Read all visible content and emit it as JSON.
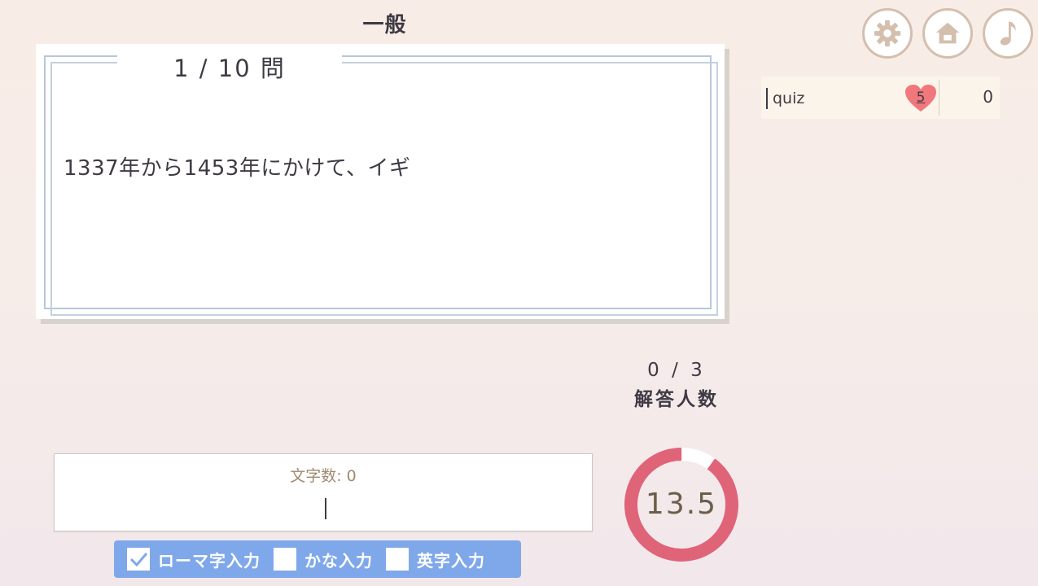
{
  "header": {
    "category": "一般"
  },
  "question": {
    "counter": "1 / 10 問",
    "text": "1337年から1453年にかけて、イギ"
  },
  "toolbar": {
    "buttons": [
      {
        "icon": "gear-icon",
        "label": "settings"
      },
      {
        "icon": "home-icon",
        "label": "home"
      },
      {
        "icon": "music-note-icon",
        "label": "sound"
      }
    ]
  },
  "players": [
    {
      "name": "quiz",
      "lives": "5",
      "score": "0"
    }
  ],
  "answers": {
    "count": "0 / 3",
    "label": "解答人数"
  },
  "timer": {
    "value": "13.5",
    "remaining_fraction": 0.9,
    "ring_color": "#e06478",
    "track_color": "#ffffff"
  },
  "input": {
    "char_count": "文字数: 0",
    "value": ""
  },
  "input_modes": [
    {
      "label": "ローマ字入力",
      "checked": true
    },
    {
      "label": "かな入力",
      "checked": false
    },
    {
      "label": "英字入力",
      "checked": false
    }
  ],
  "colors": {
    "accent": "#7fa8ea",
    "heart": "#f0787c",
    "icon_border": "#d4bfae"
  }
}
